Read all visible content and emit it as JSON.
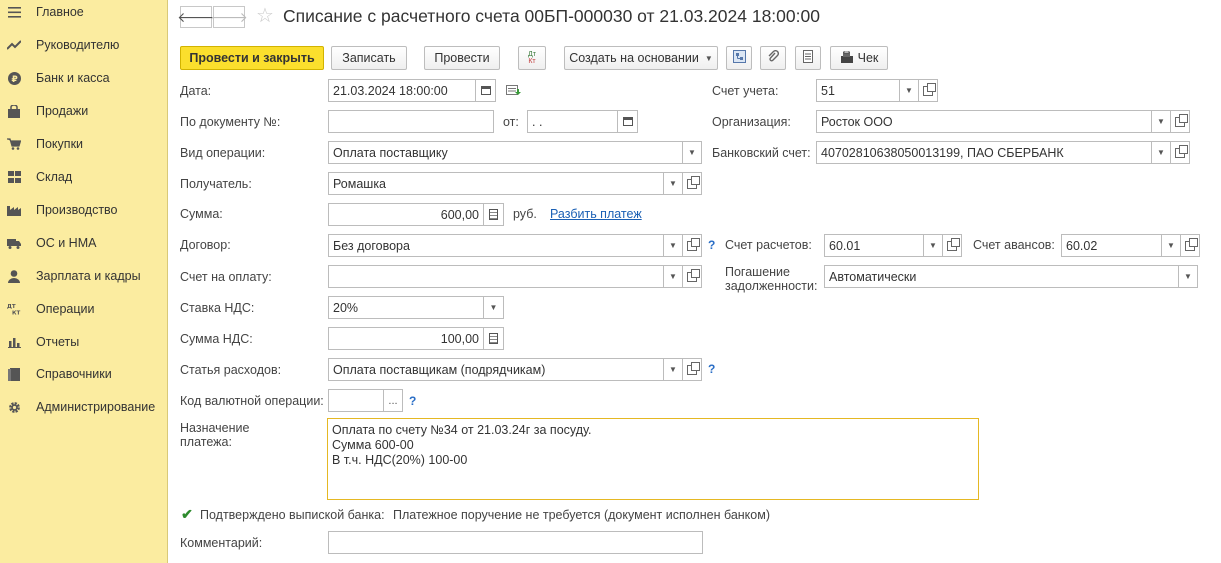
{
  "sidebar": {
    "items": [
      {
        "label": "Главное",
        "icon": "menu-icon"
      },
      {
        "label": "Руководителю",
        "icon": "trend-icon"
      },
      {
        "label": "Банк и касса",
        "icon": "ruble-icon"
      },
      {
        "label": "Продажи",
        "icon": "bag-icon"
      },
      {
        "label": "Покупки",
        "icon": "cart-icon"
      },
      {
        "label": "Склад",
        "icon": "warehouse-icon"
      },
      {
        "label": "Производство",
        "icon": "factory-icon"
      },
      {
        "label": "ОС и НМА",
        "icon": "truck-icon"
      },
      {
        "label": "Зарплата и кадры",
        "icon": "person-icon"
      },
      {
        "label": "Операции",
        "icon": "dt-kt-icon"
      },
      {
        "label": "Отчеты",
        "icon": "bar-chart-icon"
      },
      {
        "label": "Справочники",
        "icon": "book-icon"
      },
      {
        "label": "Администрирование",
        "icon": "gear-icon"
      }
    ]
  },
  "header": {
    "title": "Списание с расчетного счета 00БП-000030 от 21.03.2024 18:00:00"
  },
  "toolbar": {
    "post_close": "Провести и закрыть",
    "save": "Записать",
    "post": "Провести",
    "dt_kt_top": "Дт",
    "dt_kt_bottom": "Кт",
    "create_based": "Создать на основании",
    "receipt": "Чек"
  },
  "form": {
    "date_label": "Дата:",
    "date_value": "21.03.2024 18:00:00",
    "docnum_label": "По документу №:",
    "docnum_value": "",
    "from_label": "от:",
    "from_value": " .  .",
    "optype_label": "Вид операции:",
    "optype_value": "Оплата поставщику",
    "recipient_label": "Получатель:",
    "recipient_value": "Ромашка",
    "sum_label": "Сумма:",
    "sum_value": "600,00",
    "currency": "руб.",
    "split_link": "Разбить платеж",
    "contract_label": "Договор:",
    "contract_value": "Без договора",
    "invoice_label": "Счет на оплату:",
    "invoice_value": "",
    "vat_rate_label": "Ставка НДС:",
    "vat_rate_value": "20%",
    "vat_sum_label": "Сумма НДС:",
    "vat_sum_value": "100,00",
    "expense_label": "Статья расходов:",
    "expense_value": "Оплата поставщикам (подрядчикам)",
    "currency_op_label": "Код валютной операции:",
    "currency_op_value": "",
    "purpose_label_1": "Назначение",
    "purpose_label_2": "платежа:",
    "purpose_lines": [
      "Оплата по счету №34 от 21.03.24г за посуду.",
      "Сумма 600-00",
      "В т.ч. НДС(20%) 100-00"
    ],
    "confirmed_label": "Подтверждено выпиской банка:",
    "confirmed_checked": true,
    "confirmed_text": "Платежное поручение не требуется (документ исполнен банком)",
    "comment_label": "Комментарий:",
    "comment_value": "",
    "account_label": "Счет учета:",
    "account_value": "51",
    "org_label": "Организация:",
    "org_value": "Росток ООО",
    "bank_label": "Банковский счет:",
    "bank_value": "40702810638050013199, ПАО СБЕРБАНК",
    "settle_label": "Счет расчетов:",
    "settle_value": "60.01",
    "advance_label": "Счет авансов:",
    "advance_value": "60.02",
    "debt_label_1": "Погашение",
    "debt_label_2": "задолженности:",
    "debt_value": "Автоматически",
    "help": "?"
  },
  "colors": {
    "sidebar_bg": "#fbeca0",
    "primary_button": "#fbdf2d",
    "link": "#1a5fb4",
    "textarea_border": "#e5b823"
  }
}
